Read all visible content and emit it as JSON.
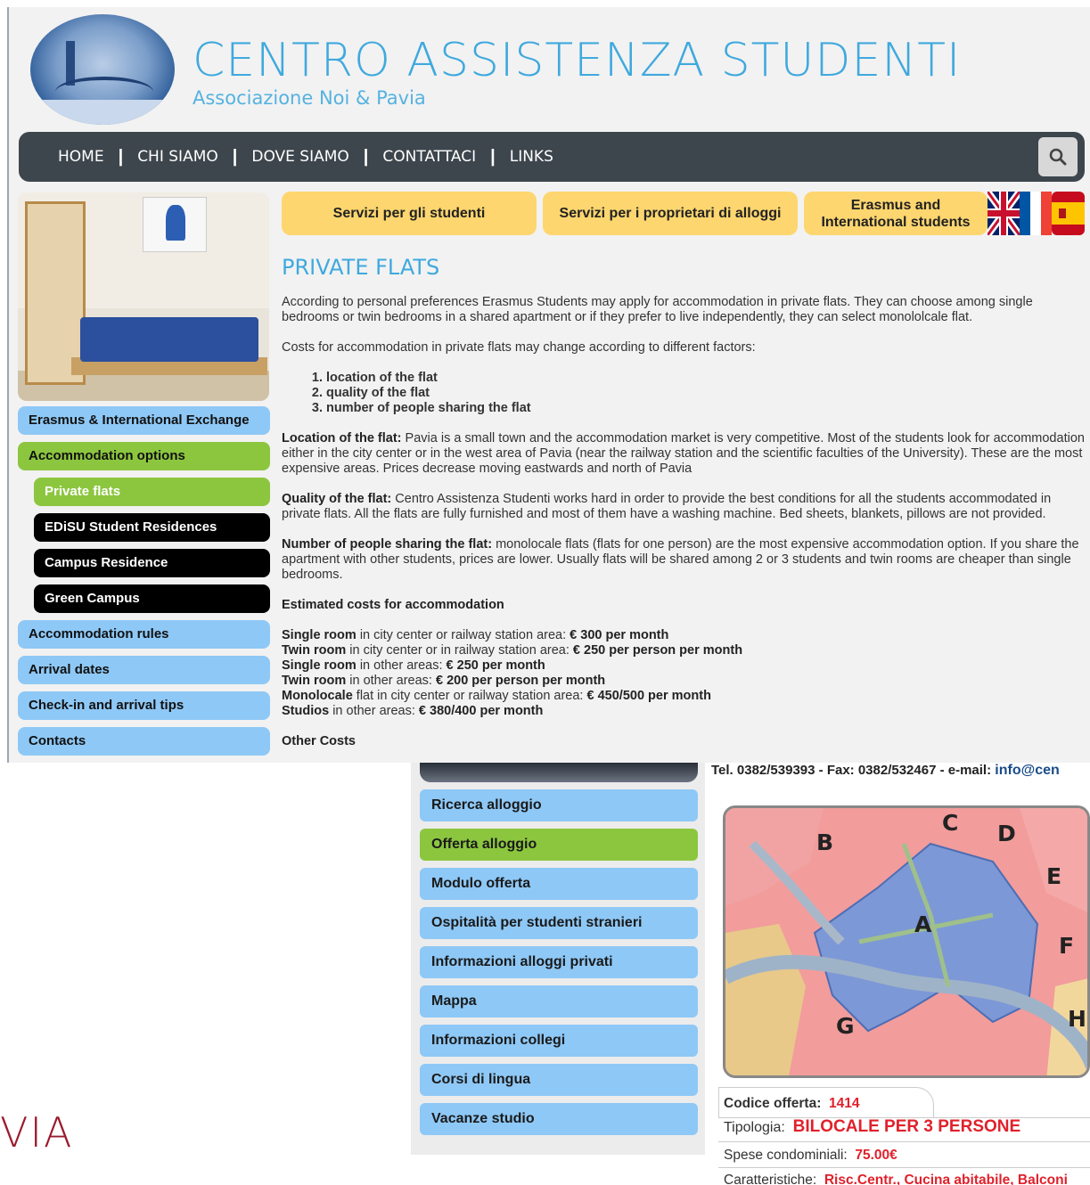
{
  "site": {
    "title": "CENTRO ASSISTENZA STUDENTI",
    "subtitle": "Associazione Noi & Pavia"
  },
  "nav": {
    "items": [
      "HOME",
      "CHI SIAMO",
      "DOVE SIAMO",
      "CONTATTACI",
      "LINKS"
    ],
    "separator": "|",
    "search_icon": "search-icon"
  },
  "top_buttons": {
    "students": "Servizi per gli studenti",
    "owners": "Servizi per i proprietari di alloggi",
    "erasmus": "Erasmus and International students"
  },
  "flags": [
    "uk-flag",
    "france-flag",
    "spain-flag"
  ],
  "sidebar": {
    "items": [
      {
        "label": "Erasmus & International Exchange",
        "style": "blue"
      },
      {
        "label": "Accommodation options",
        "style": "green"
      },
      {
        "label": "Private flats",
        "style": "green-active"
      },
      {
        "label": "EDiSU Student Residences",
        "style": "black"
      },
      {
        "label": "Campus Residence",
        "style": "black"
      },
      {
        "label": "Green Campus",
        "style": "black"
      },
      {
        "label": "Accommodation rules",
        "style": "blue"
      },
      {
        "label": "Arrival dates",
        "style": "blue"
      },
      {
        "label": "Check-in and arrival tips",
        "style": "blue"
      },
      {
        "label": "Contacts",
        "style": "blue"
      }
    ]
  },
  "content": {
    "heading": "PRIVATE FLATS",
    "intro": "According to personal preferences Erasmus Students may apply for accommodation in private flats. They can choose among single bedrooms or twin bedrooms in a shared apartment or if they prefer to live independently, they can select monololcale flat.",
    "costs_intro": "Costs for accommodation in private flats may change according to different factors:",
    "factors": [
      "location of the flat",
      "quality of the flat",
      "number of people sharing the flat"
    ],
    "location_label": "Location of the flat:",
    "location_text": " Pavia is a small town and the accommodation market is very competitive. Most of the students look for accommodation either in the city center or in the west area of Pavia (near the railway station and the scientific faculties of the University). These are the most expensive areas. Prices decrease moving eastwards and north of Pavia",
    "quality_label": "Quality of the flat:",
    "quality_text": " Centro Assistenza Studenti works hard in order to provide the best conditions for all the students accommodated in private flats. All the flats are fully furnished and most of them have a washing machine. Bed sheets, blankets, pillows are not provided.",
    "people_label": "Number of people sharing the flat:",
    "people_text": " monolocale flats (flats for one person) are the most expensive accommodation option. If you share the apartment with other students, prices are lower. Usually flats will be shared among 2 or 3 students and twin rooms are cheaper than single bedrooms.",
    "estimated_heading": "Estimated costs for accommodation",
    "costs": [
      {
        "type": "Single room",
        "area": " in city center or railway station area: ",
        "price": "€ 300 per month"
      },
      {
        "type": "Twin room",
        "area": " in city center or in railway station area: ",
        "price": "€ 250 per person per month"
      },
      {
        "type": "Single room",
        "area": " in other areas: ",
        "price": "€ 250 per month"
      },
      {
        "type": "Twin room",
        "area": " in other areas: ",
        "price": "€ 200 per person per month"
      },
      {
        "type": "Monolocale",
        "area": " flat in city center or railway station area: ",
        "price": "€ 450/500 per month"
      },
      {
        "type": "Studios",
        "area": " in other areas: ",
        "price": "€ 380/400 per month"
      }
    ],
    "other_costs": "Other Costs"
  },
  "fragment_logo": "VIA",
  "bottom": {
    "tel_line": "Tel. 0382/539393 - Fax: 0382/532467 - e-mail: ",
    "email": "info@cen",
    "menu": [
      {
        "label": "Ricerca alloggio",
        "style": "blue"
      },
      {
        "label": "Offerta alloggio",
        "style": "green"
      },
      {
        "label": "Modulo offerta",
        "style": "blue"
      },
      {
        "label": "Ospitalità per studenti stranieri",
        "style": "blue"
      },
      {
        "label": "Informazioni alloggi privati",
        "style": "blue"
      },
      {
        "label": "Mappa",
        "style": "blue"
      },
      {
        "label": "Informazioni collegi",
        "style": "blue"
      },
      {
        "label": "Corsi di lingua",
        "style": "blue"
      },
      {
        "label": "Vacanze studio",
        "style": "blue"
      }
    ],
    "map_zones": [
      "A",
      "B",
      "C",
      "D",
      "E",
      "F",
      "G",
      "H"
    ],
    "offer": {
      "code_label": "Codice offerta:",
      "code_value": "1414",
      "type_label": "Tipologia:",
      "type_value": "BILOCALE PER 3 PERSONE",
      "fees_label": "Spese condominiali:",
      "fees_value": "75.00€",
      "features_label": "Caratteristiche:",
      "features_value": "Risc.Centr., Cucina abitabile, Balconi"
    }
  },
  "colors": {
    "accent_blue": "#3fa9de",
    "nav_bg": "#3d464d",
    "menu_blue": "#8ec8f6",
    "menu_green": "#8cc63f",
    "button_yellow": "#fdd66f",
    "offer_red": "#e0212b"
  }
}
